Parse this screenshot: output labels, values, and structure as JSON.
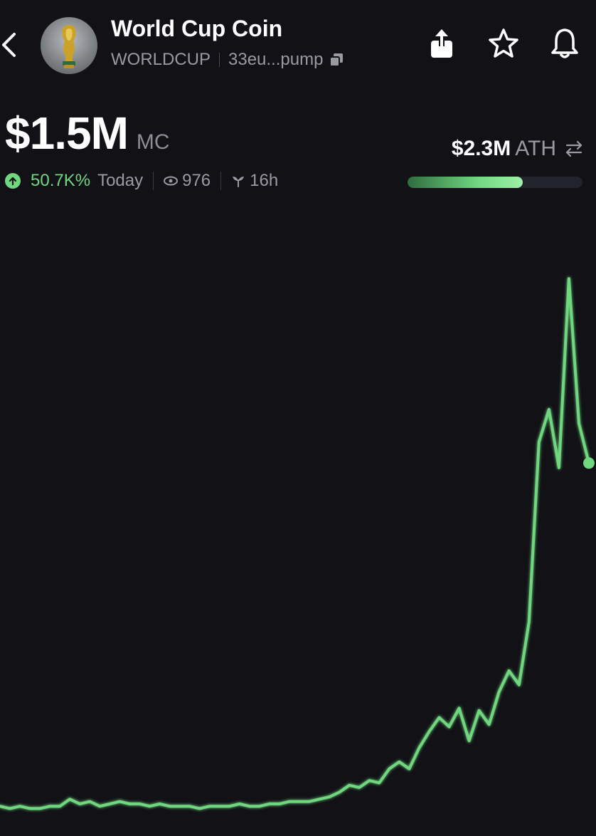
{
  "header": {
    "coin_name": "World Cup Coin",
    "ticker": "WORLDCUP",
    "address": "33eu...pump",
    "icons": {
      "back": "chevron-left-icon",
      "copy": "copy-icon",
      "share": "share-icon",
      "favorite": "star-icon",
      "alert": "bell-icon"
    }
  },
  "market": {
    "cap_value": "$1.5M",
    "cap_label": "MC",
    "change_pct": "50.7K%",
    "change_period": "Today",
    "viewers": "976",
    "age": "16h",
    "ath_value": "$2.3M",
    "ath_label": "ATH",
    "ath_progress": 0.66
  },
  "colors": {
    "background": "#111116",
    "accent_green": "#6fd77f",
    "text_secondary": "#9a9ba2"
  },
  "chart_data": {
    "type": "line",
    "title": "",
    "xlabel": "",
    "ylabel": "",
    "ylim": [
      0,
      2.3
    ],
    "grid": false,
    "series": [
      {
        "values": [
          0.03,
          0.02,
          0.03,
          0.02,
          0.02,
          0.03,
          0.03,
          0.06,
          0.04,
          0.05,
          0.03,
          0.04,
          0.05,
          0.04,
          0.04,
          0.03,
          0.04,
          0.03,
          0.03,
          0.03,
          0.02,
          0.03,
          0.03,
          0.03,
          0.04,
          0.03,
          0.03,
          0.04,
          0.04,
          0.05,
          0.05,
          0.05,
          0.06,
          0.07,
          0.09,
          0.12,
          0.11,
          0.14,
          0.13,
          0.19,
          0.22,
          0.19,
          0.28,
          0.35,
          0.41,
          0.37,
          0.45,
          0.31,
          0.44,
          0.38,
          0.52,
          0.61,
          0.55,
          0.82,
          1.59,
          1.73,
          1.48,
          2.29,
          1.67,
          1.5
        ]
      }
    ]
  }
}
